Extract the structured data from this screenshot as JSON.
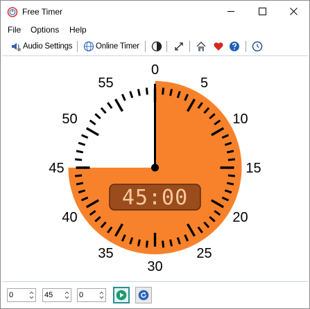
{
  "window": {
    "title": "Free Timer"
  },
  "menu": {
    "items": [
      "File",
      "Options",
      "Help"
    ]
  },
  "toolbar": {
    "audio_settings": "Audio Settings",
    "online_timer": "Online Timer"
  },
  "timer": {
    "display": "45:00",
    "set_minutes": 45,
    "dial_max_minutes": 60,
    "labels": [
      "0",
      "5",
      "10",
      "15",
      "20",
      "25",
      "30",
      "35",
      "40",
      "45",
      "50",
      "55"
    ],
    "fill_color": "#f7822b",
    "display_bg": "#9b4c1c",
    "display_text_color": "#f6c99e"
  },
  "controls": {
    "hours_value": "0",
    "minutes_value": "45",
    "seconds_value": "0"
  }
}
